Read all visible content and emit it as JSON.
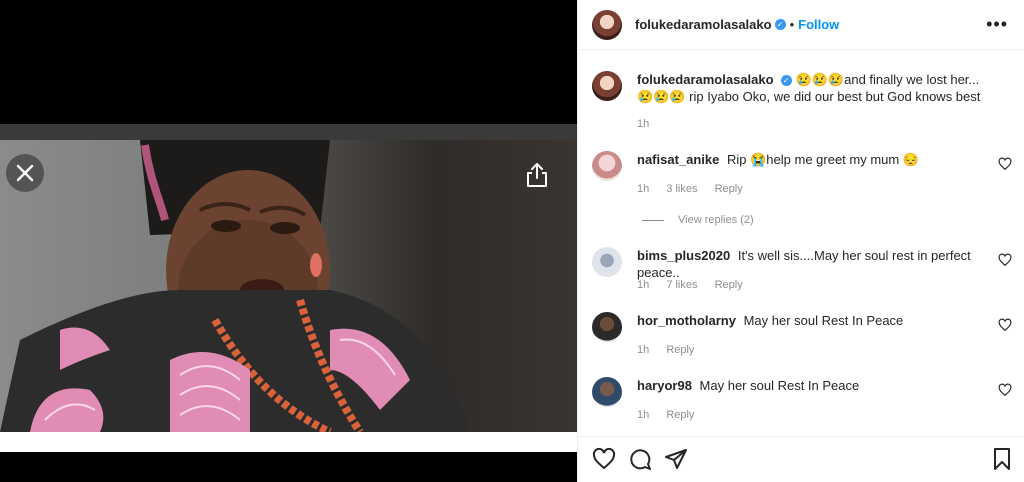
{
  "post": {
    "username": "folukedaramolasalako",
    "follow_label": "Follow",
    "separator": "•",
    "more_label": "•••"
  },
  "caption": {
    "username": "folukedaramolasalako",
    "text": "😢😢😢and finally we lost her...😢😢😢 rip Iyabo Oko, we did our best but God knows best",
    "time": "1h"
  },
  "comments": [
    {
      "username": "nafisat_anike",
      "text": "Rip 😭help me greet my mum 😔",
      "time": "1h",
      "likes": "3 likes",
      "reply": "Reply"
    },
    {
      "username": "bims_plus2020",
      "text": "It's well sis....May her soul rest in perfect peace..",
      "time": "1h",
      "likes": "7 likes",
      "reply": "Reply"
    },
    {
      "username": "hor_motholarny",
      "text": "May her soul Rest In Peace",
      "time": "1h",
      "reply": "Reply"
    },
    {
      "username": "haryor98",
      "text": "May her soul Rest In Peace",
      "time": "1h",
      "reply": "Reply"
    }
  ],
  "view_replies": "View replies (2)",
  "icons": {
    "close": "close-icon",
    "share": "share-icon",
    "heart": "heart-icon",
    "comment": "comment-icon",
    "send": "send-icon",
    "bookmark": "bookmark-icon"
  },
  "colors": {
    "link": "#0095f6",
    "muted": "#8e8e8e",
    "verified": "#3897f0"
  }
}
